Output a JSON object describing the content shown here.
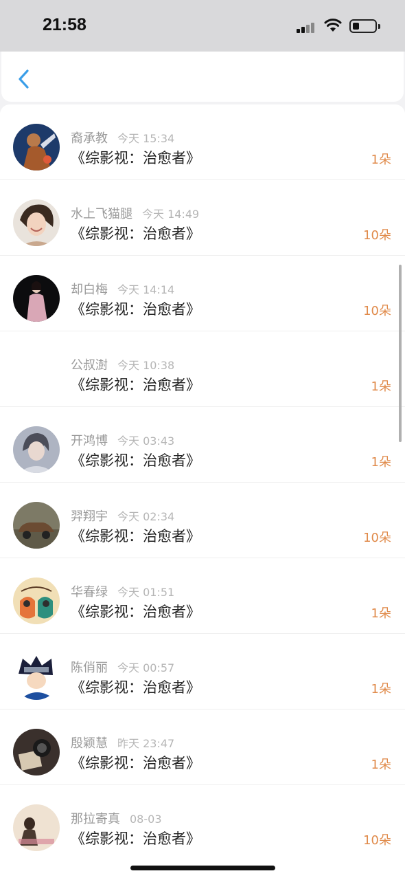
{
  "status_bar": {
    "time": "21:58"
  },
  "items": [
    {
      "name": "裔承教",
      "time": "今天 15:34",
      "title": "《综影视：治愈者》",
      "count": "1朵",
      "avatar": "armored-hero-avatar"
    },
    {
      "name": "水上飞猫腿",
      "time": "今天 14:49",
      "title": "《综影视：治愈者》",
      "count": "10朵",
      "avatar": "smiling-woman-avatar"
    },
    {
      "name": "却白梅",
      "time": "今天 14:14",
      "title": "《综影视：治愈者》",
      "count": "10朵",
      "avatar": "pink-coat-woman-avatar"
    },
    {
      "name": "公叔澍",
      "time": "今天 10:38",
      "title": "《综影视：治愈者》",
      "count": "1朵",
      "avatar": ""
    },
    {
      "name": "开鸿博",
      "time": "今天 03:43",
      "title": "《综影视：治愈者》",
      "count": "1朵",
      "avatar": "girl-portrait-avatar"
    },
    {
      "name": "羿翔宇",
      "time": "今天 02:34",
      "title": "《综影视：治愈者》",
      "count": "10朵",
      "avatar": "vintage-car-avatar"
    },
    {
      "name": "华春绿",
      "time": "今天 01:51",
      "title": "《综影视：治愈者》",
      "count": "1朵",
      "avatar": "gemini-owls-avatar"
    },
    {
      "name": "陈俏丽",
      "time": "今天 00:57",
      "title": "《综影视：治愈者》",
      "count": "1朵",
      "avatar": "ninja-cartoon-avatar"
    },
    {
      "name": "殷颖慧",
      "time": "昨天 23:47",
      "title": "《综影视：治愈者》",
      "count": "1朵",
      "avatar": "camera-avatar"
    },
    {
      "name": "那拉寄真",
      "time": "08-03",
      "title": "《综影视：治愈者》",
      "count": "10朵",
      "avatar": "person-photo-avatar"
    }
  ],
  "colors": {
    "accent": "#3a9ee8",
    "count": "#e08a4a"
  }
}
